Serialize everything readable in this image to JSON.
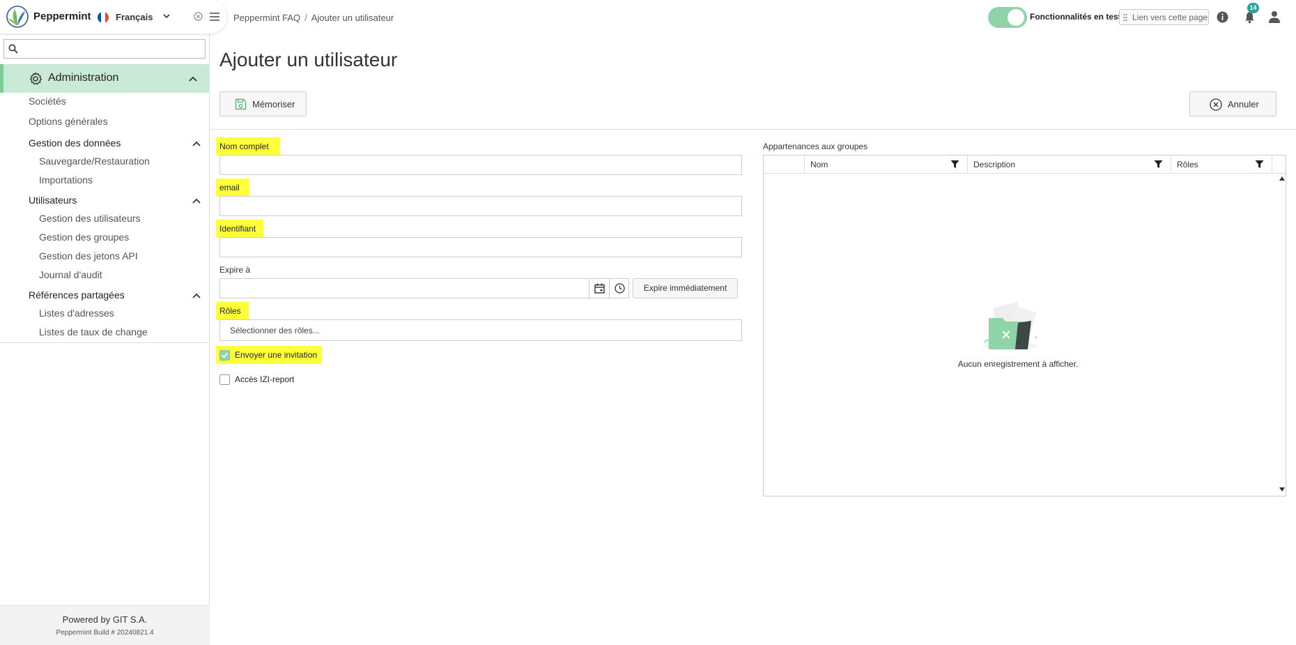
{
  "app": {
    "name": "Peppermint",
    "language": "Français",
    "flag_colors": [
      "#0055a4",
      "#ffffff",
      "#ef4135"
    ]
  },
  "colors": {
    "accent": "#8fd3a9",
    "accent_dark": "#7ccc9a",
    "nav_active_bg": "#c9ead5",
    "highlight": "#ffff3b",
    "badge": "#26a69a"
  },
  "sidebar": {
    "search_placeholder": "",
    "admin_label": "Administration",
    "links": {
      "societes": "Sociétés",
      "options": "Options générales",
      "gestion_donnees": "Gestion des données",
      "sauvegarde": "Sauvegarde/Restauration",
      "importations": "Importations",
      "utilisateurs": "Utilisateurs",
      "gestion_utilisateurs": "Gestion des utilisateurs",
      "gestion_groupes": "Gestion des groupes",
      "gestion_jetons": "Gestion des jetons API",
      "journal": "Journal d'audit",
      "references": "Références partagées",
      "listes_adresses": "Listes d'adresses",
      "listes_taux": "Listes de taux de change"
    },
    "footer": {
      "powered": "Powered by GIT S.A.",
      "build": "Peppermint Build # 20240821.4"
    }
  },
  "topbar": {
    "breadcrumb": [
      "Peppermint FAQ",
      "Ajouter un utilisateur"
    ],
    "breadcrumb_sep": "/",
    "feature_toggle_label": "Fonctionnalités en test",
    "feature_toggle_on": true,
    "link_label": "Lien vers cette page",
    "notification_count": "14"
  },
  "page": {
    "title": "Ajouter un utilisateur",
    "save_label": "Mémoriser",
    "cancel_label": "Annuler"
  },
  "form": {
    "full_name_label": "Nom complet",
    "full_name_value": "",
    "email_label": "email",
    "email_value": "",
    "identifier_label": "Identifiant",
    "identifier_value": "",
    "expires_label": "Expire à",
    "expires_value": "",
    "expire_now_label": "Expire immédiatement",
    "roles_label": "Rôles",
    "roles_placeholder": "Sélectionner des rôles...",
    "send_invite_label": "Envoyer une invitation",
    "send_invite_checked": true,
    "izi_label": "Accès IZI-report",
    "izi_checked": false
  },
  "groups": {
    "title": "Appartenances aux groupes",
    "columns": [
      "Nom",
      "Description",
      "Rôles"
    ],
    "rows": [],
    "empty_message": "Aucun enregistrement à afficher."
  }
}
